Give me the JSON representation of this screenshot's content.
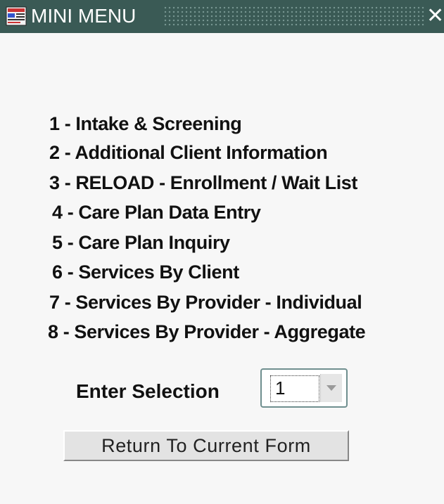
{
  "window": {
    "title": "MINI MENU",
    "close_glyph": "✕",
    "icon": "app-form-icon"
  },
  "menu": {
    "items": [
      "1 - Intake & Screening",
      "2 - Additional Client Information",
      "3 - RELOAD - Enrollment / Wait List",
      "4 - Care Plan Data Entry",
      "5 - Care Plan Inquiry",
      "6 - Services  By Client",
      "7 - Services  By Provider - Individual",
      "8 - Services  By Provider - Aggregate"
    ]
  },
  "selection": {
    "label": "Enter Selection",
    "value": "1"
  },
  "buttons": {
    "return_label": "Return To Current Form"
  }
}
